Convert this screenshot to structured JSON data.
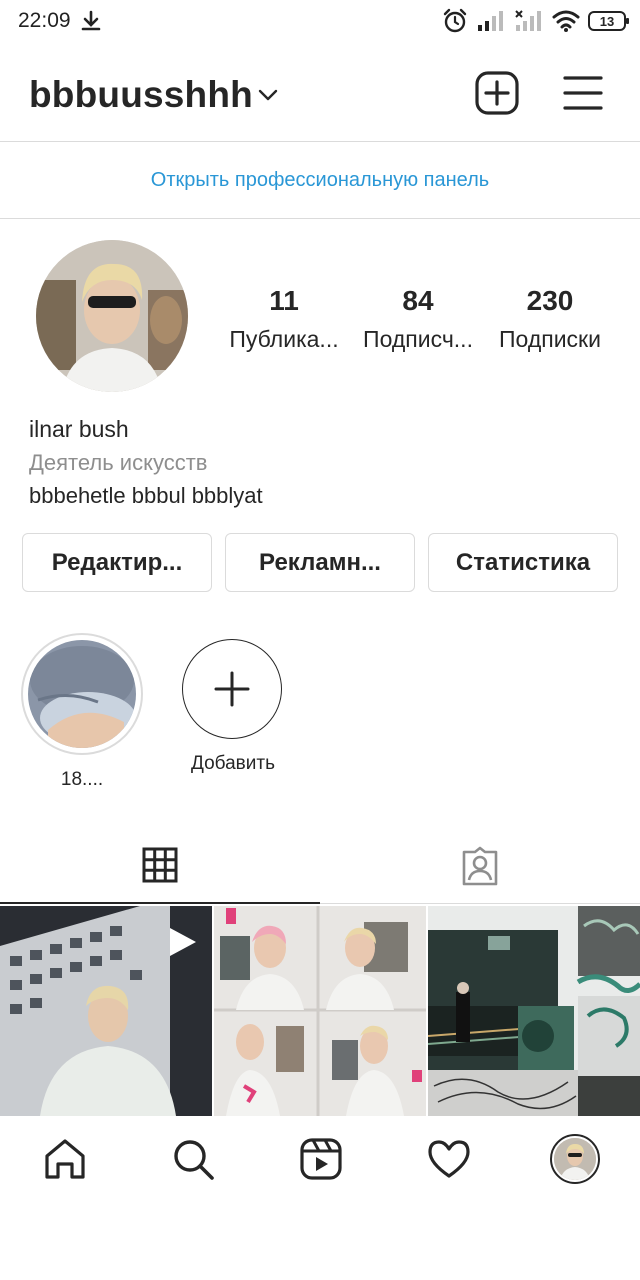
{
  "status_bar": {
    "time": "22:09",
    "battery": "13"
  },
  "header": {
    "username": "bbbuusshhh"
  },
  "pro_panel": {
    "link_label": "Открыть профессиональную панель"
  },
  "profile": {
    "posts_count": "11",
    "posts_label": "Публика...",
    "followers_count": "84",
    "followers_label": "Подписч...",
    "following_count": "230",
    "following_label": "Подписки",
    "name": "ilnar bush",
    "category": "Деятель искусств",
    "bio": "bbbehetle bbbul bbblyat"
  },
  "buttons": {
    "edit": "Редактир...",
    "promote": "Рекламн...",
    "insights": "Статистика"
  },
  "highlights": [
    {
      "label": "18...."
    },
    {
      "label": "Добавить"
    }
  ],
  "tabs": {
    "active": "grid"
  },
  "colors": {
    "link": "#2a97d6",
    "border": "#dbdbdb",
    "text": "#262626",
    "secondary": "#8e8e8e"
  }
}
